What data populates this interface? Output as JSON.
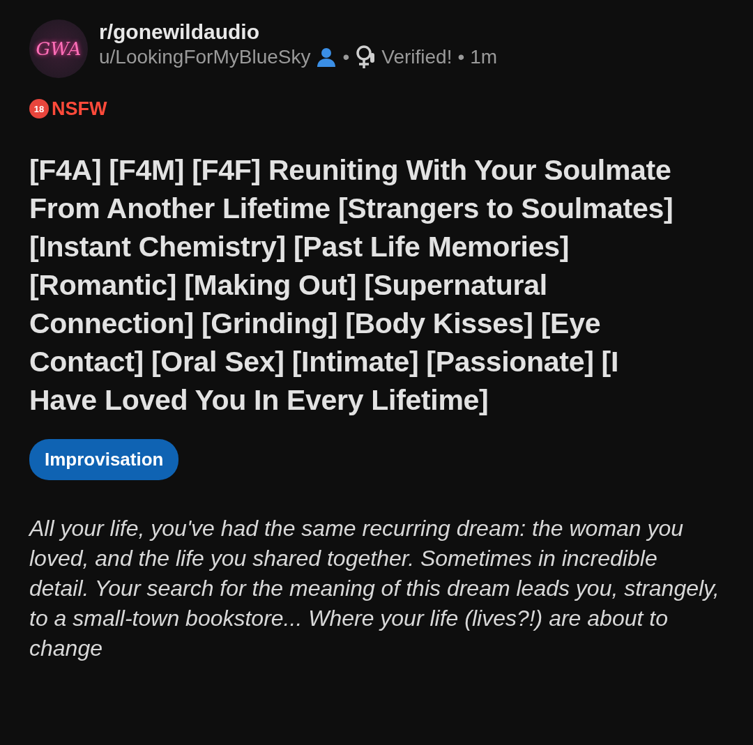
{
  "subreddit": {
    "name": "r/gonewildaudio",
    "avatar_text": "GWA"
  },
  "meta": [
    {
      "kind": "user",
      "text": "u/LookingForMyBlueSky"
    },
    {
      "kind": "separator",
      "text": "•"
    },
    {
      "kind": "flair",
      "text": "Verified!"
    },
    {
      "kind": "separator",
      "text": "•"
    },
    {
      "kind": "time",
      "text": "1m"
    }
  ],
  "nsfw": {
    "age": "18",
    "label": "NSFW"
  },
  "title": "[F4A] [F4M] [F4F] Reuniting With Your Soulmate From Another Lifetime [Strangers to Soulmates] [Instant Chemistry] [Past Life Memories] [Romantic] [Making Out] [Supernatural Connection] [Grinding] [Body Kisses] [Eye Contact] [Oral Sex] [Intimate] [Passionate] [I Have Loved You In Every Lifetime]",
  "post_flair": "Improvisation",
  "body": "All your life, you've had the same recurring dream: the woman you loved, and the life you shared together. Sometimes in incredible detail. Your search for the meaning of this dream leads you, strangely, to a small-town bookstore... Where your life (lives?!) are about to change"
}
